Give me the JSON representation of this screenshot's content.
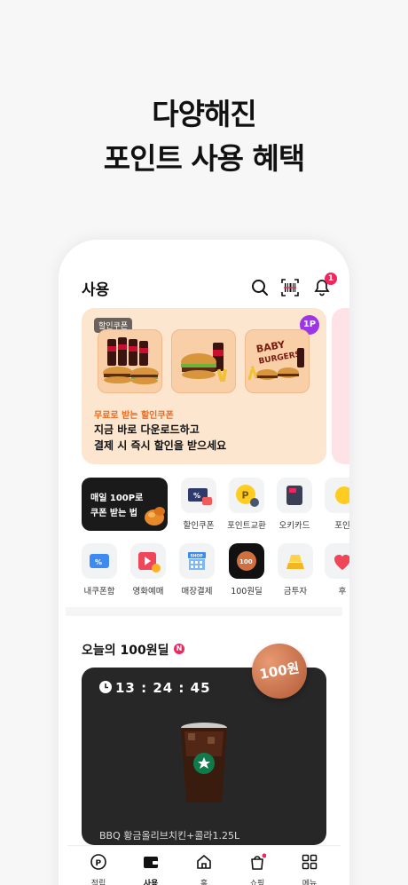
{
  "hero": {
    "line1": "다양해진",
    "line2": "포인트 사용 혜택"
  },
  "header": {
    "title": "사용",
    "notification_count": "1"
  },
  "banner": {
    "tag": "할인쿠폰",
    "points_badge": "1P",
    "sub": "무료로 받는 할인쿠폰",
    "line1": "지금 바로 다운로드하고",
    "line2": "결제 시 즉시 할인을 받으세요"
  },
  "promo": {
    "line1": "매일 100P로",
    "line2": "쿠폰 받는 법"
  },
  "quick_row1": [
    {
      "label": "할인쿠폰"
    },
    {
      "label": "포인트교환"
    },
    {
      "label": "오키카드"
    },
    {
      "label": "포인"
    }
  ],
  "quick_row2": [
    {
      "label": "내쿠폰함"
    },
    {
      "label": "영화예매"
    },
    {
      "label": "매장결제"
    },
    {
      "label": "100원딜"
    },
    {
      "label": "금투자"
    },
    {
      "label": "후"
    }
  ],
  "deal": {
    "title": "오늘의 100원딜",
    "new_badge": "N",
    "timer": "13 : 24 : 45",
    "medal": "100원",
    "product": "BBQ 황금올리브치킨+콜라1.25L"
  },
  "tabs": [
    {
      "label": "적립"
    },
    {
      "label": "사용"
    },
    {
      "label": "홈"
    },
    {
      "label": "쇼핑"
    },
    {
      "label": "메뉴"
    }
  ],
  "colors": {
    "accent": "#f06a1c",
    "badge": "#f2265e",
    "points": "#9b35e6",
    "banner_bg": "#fde6cf"
  }
}
